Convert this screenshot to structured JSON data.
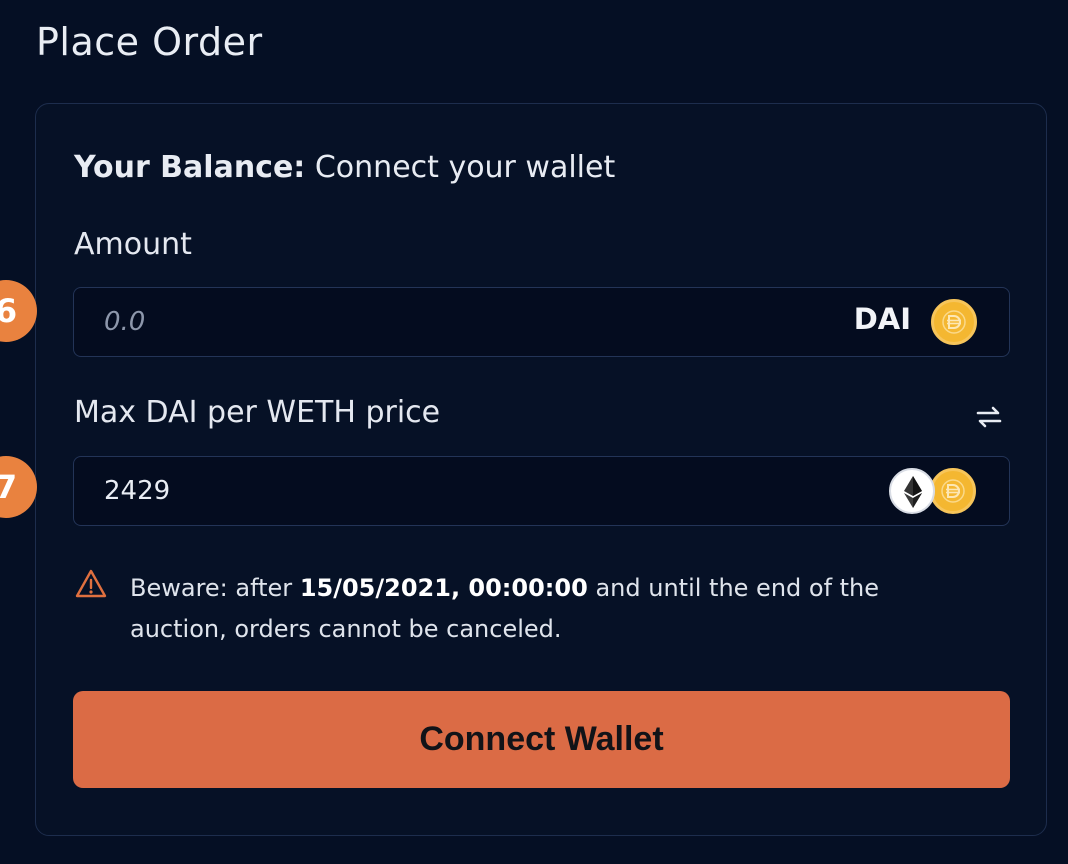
{
  "page": {
    "title": "Place Order"
  },
  "balance": {
    "label": "Your Balance:",
    "value": "Connect your wallet"
  },
  "amount": {
    "label": "Amount",
    "placeholder": "0.0",
    "token": "DAI",
    "token_icon": "dai-icon",
    "step_number": "6"
  },
  "price": {
    "label": "Max DAI per WETH price",
    "value": "2429",
    "swap_icon": "swap-icon",
    "token_icons": [
      "eth-icon",
      "dai-icon"
    ],
    "step_number": "7"
  },
  "warning": {
    "icon": "warning-icon",
    "prefix": "Beware: after",
    "datetime": "15/05/2021, 00:00:00",
    "suffix": "and until the end of the auction, orders cannot be canceled."
  },
  "connect_button": {
    "label": "Connect Wallet"
  },
  "colors": {
    "background": "#050f24",
    "accent": "#db6b45",
    "badge": "#e9823f",
    "dai": "#f4b731"
  }
}
